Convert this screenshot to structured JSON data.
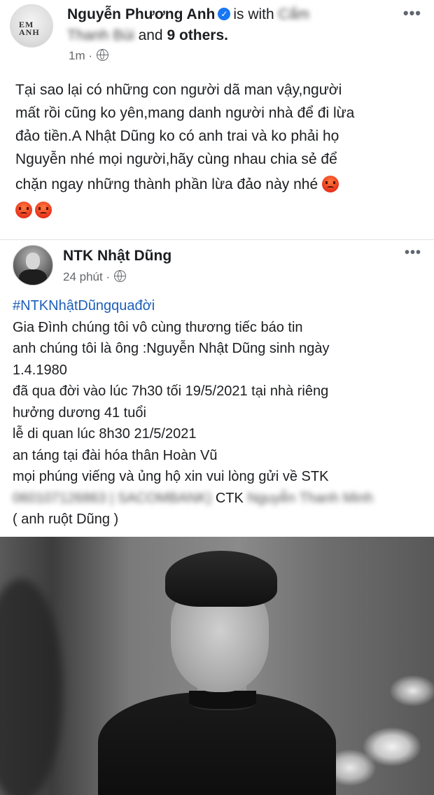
{
  "post": {
    "author": "Nguyễn Phương Anh",
    "with_text": "is with",
    "tagged_blur_1": "Cẩm",
    "tagged_blur_2": "Thanh Bùi",
    "and_text": "and",
    "others": "9 others.",
    "time": "1m ·",
    "body_lines": [
      "Tại sao lại có những con người dã man vậy,người",
      "mất rồi cũng ko yên,mang danh người nhà để đi lừa",
      "đảo tiền.A Nhật Dũng ko có anh trai và ko phải họ",
      "Nguyễn nhé mọi người,hãy cùng nhau chia sẻ để",
      "chặn ngay những thành phần lừa đảo này nhé"
    ],
    "more_icon": "•••"
  },
  "shared": {
    "author": "NTK Nhật Dũng",
    "time": "24 phút ·",
    "more_icon": "•••",
    "hashtag": "#NTKNhậtDũngquađời",
    "lines": [
      "Gia Đình chúng tôi vô cùng thương tiếc báo tin",
      "anh chúng tôi là ông :Nguyễn Nhật Dũng sinh ngày",
      "1.4.1980",
      "đã qua đời vào lúc 7h30 tối 19/5/2021 tại nhà riêng",
      "hưởng dương 41 tuổi",
      "lễ di quan lúc 8h30 21/5/2021",
      "an táng tại đài hóa thân Hoàn Vũ",
      "mọi phúng viếng và ủng hộ xin vui lòng gửi về STK"
    ],
    "account_blur": "060107126863 | SACOMBANK)",
    "ctk_label": "CTK",
    "ctk_blur": "Nguyễn Thanh Minh",
    "closing": "( anh ruột Dũng )"
  }
}
